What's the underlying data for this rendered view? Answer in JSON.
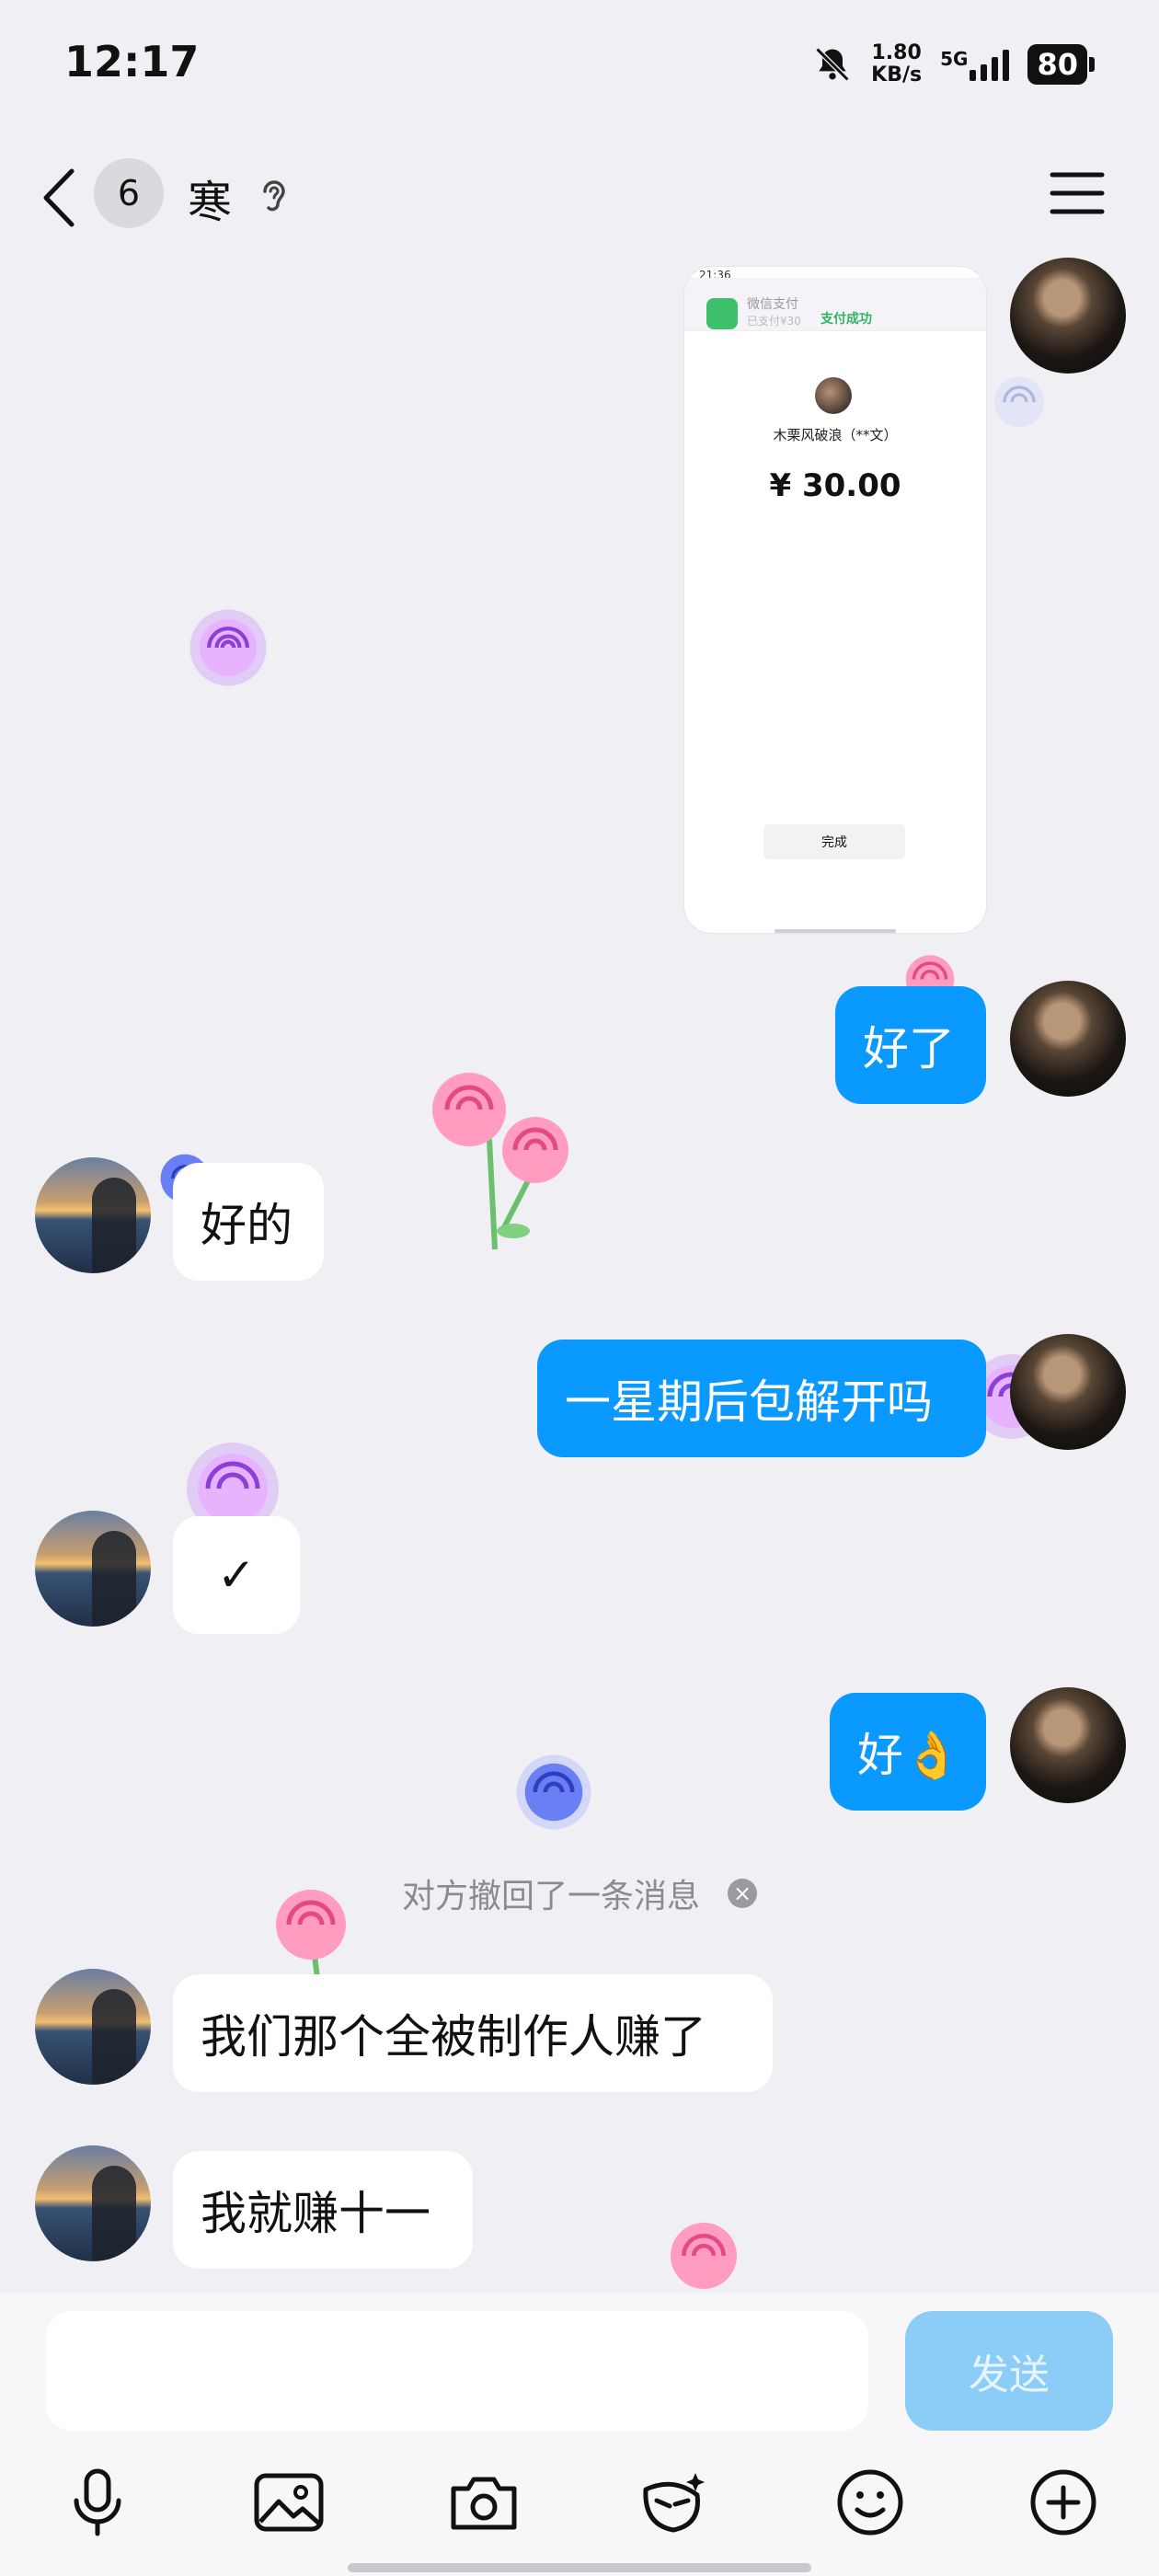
{
  "status_bar": {
    "time": "12:17",
    "net_speed_value": "1.80",
    "net_speed_unit": "KB/s",
    "network": "5G",
    "battery": "80"
  },
  "header": {
    "unread_count": "6",
    "title": "寒"
  },
  "payment_screenshot": {
    "status_time": "21:36",
    "notify_app": "微信支付",
    "notify_sub": "已支付¥30",
    "notify_status": "支付成功",
    "payee": "木栗风破浪（**文）",
    "amount": "¥ 30.00",
    "done_label": "完成"
  },
  "messages": [
    {
      "side": "out",
      "text": "好了"
    },
    {
      "side": "in",
      "text": "好的"
    },
    {
      "side": "out",
      "text": "一星期后包解开吗"
    },
    {
      "side": "in",
      "text": "✓"
    },
    {
      "side": "out",
      "text": "好👌"
    },
    {
      "side": "in",
      "text": "我们那个全被制作人赚了"
    },
    {
      "side": "in",
      "text": "我就赚十一"
    }
  ],
  "recall_notice": "对方撤回了一条消息",
  "composer": {
    "placeholder": "",
    "send_label": "发送"
  },
  "toolbar_icons": [
    "microphone-icon",
    "image-icon",
    "camera-icon",
    "magic-emoji-icon",
    "smiley-icon",
    "plus-icon"
  ],
  "colors": {
    "background": "#efeff4",
    "outgoing_bubble": "#0a99ff",
    "incoming_bubble": "#ffffff",
    "send_button": "#8ccdf8"
  }
}
